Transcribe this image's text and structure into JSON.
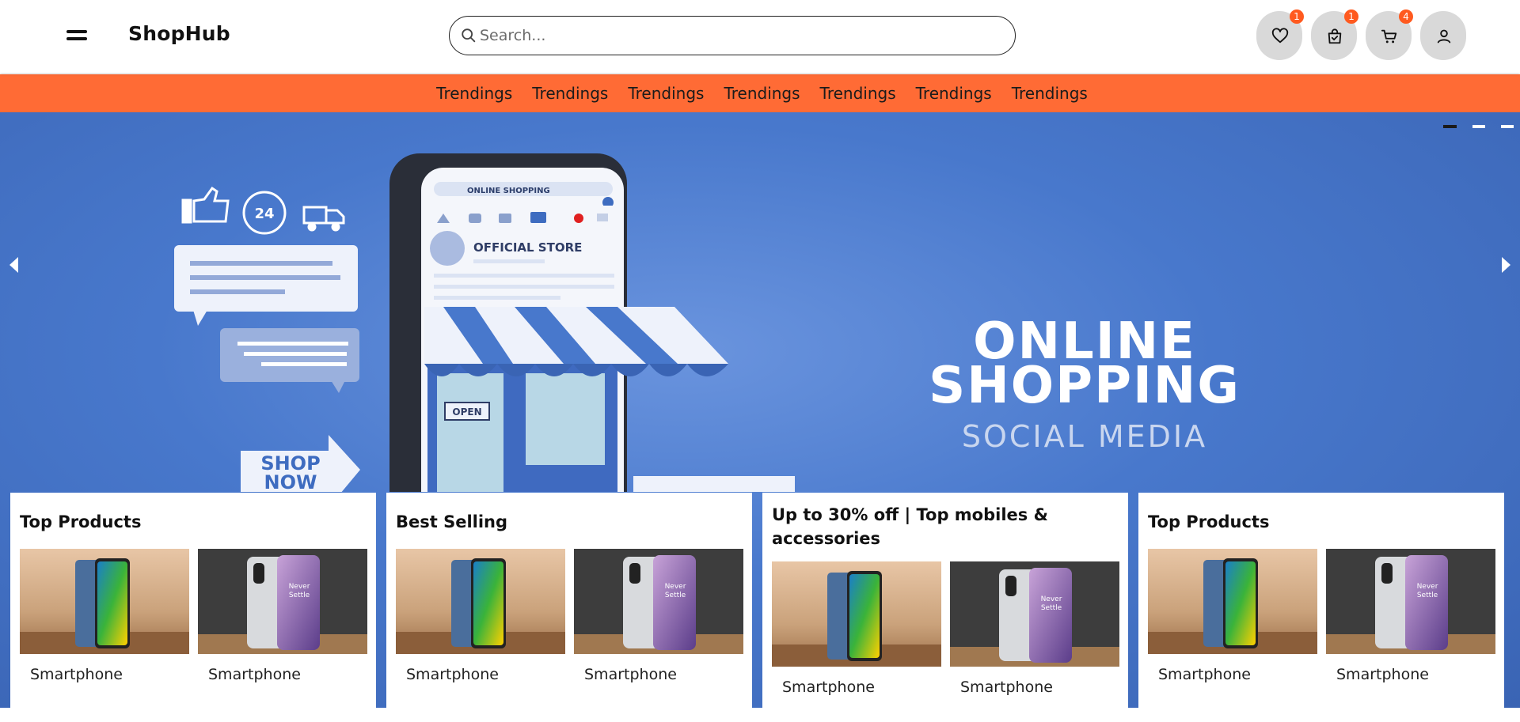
{
  "header": {
    "brand": "ShopHub",
    "search_placeholder": "Search...",
    "badges": {
      "wishlist": "1",
      "orders": "1",
      "cart": "4"
    }
  },
  "nav": {
    "items": [
      "Trendings",
      "Trendings",
      "Trendings",
      "Trendings",
      "Trendings",
      "Trendings",
      "Trendings"
    ]
  },
  "hero": {
    "title_line1": "ONLINE",
    "title_line2": "SHOPPING",
    "subtitle": "SOCIAL MEDIA",
    "sign_line1": "SHOP",
    "sign_line2": "NOW",
    "store_label": "OFFICIAL STORE",
    "phone_search": "ONLINE SHOPPING",
    "door_sign": "OPEN",
    "badge_24": "24"
  },
  "cards": [
    {
      "title": "Top Products",
      "products": [
        {
          "name": "Smartphone"
        },
        {
          "name": "Smartphone"
        }
      ]
    },
    {
      "title": "Best Selling",
      "products": [
        {
          "name": "Smartphone"
        },
        {
          "name": "Smartphone"
        }
      ]
    },
    {
      "title": "Up to 30% off | Top mobiles & accessories",
      "products": [
        {
          "name": "Smartphone"
        },
        {
          "name": "Smartphone"
        }
      ]
    },
    {
      "title": "Top Products",
      "products": [
        {
          "name": "Smartphone"
        },
        {
          "name": "Smartphone"
        }
      ]
    }
  ],
  "colors": {
    "accent": "#ff6b35",
    "hero_blue": "#4878cc",
    "badge": "#ff5a1f",
    "icon_bg": "#d9d9d9"
  },
  "icons": {
    "menu": "hamburger-icon",
    "search": "search-icon",
    "wishlist": "heart-icon",
    "orders": "bag-check-icon",
    "cart": "cart-icon",
    "account": "user-icon"
  }
}
